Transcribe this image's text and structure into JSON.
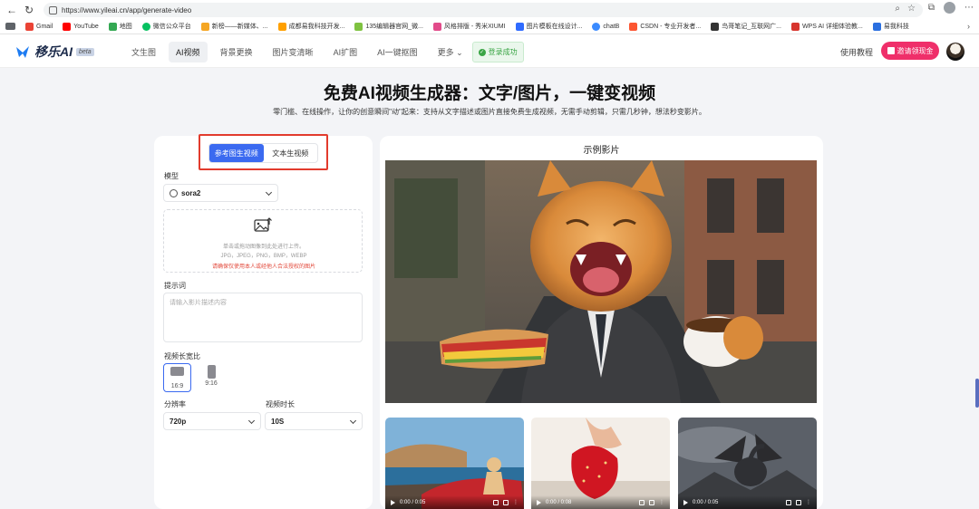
{
  "browser": {
    "url": "https://www.yileai.cn/app/generate-video",
    "bookmarks": [
      "Gmail",
      "YouTube",
      "地图",
      "微信公众平台",
      "新榜——新媒体、...",
      "成都易我科技开发...",
      "135编辑器官网_微...",
      "风格排版 - 秀米XIUMI",
      "图片模板在线设计...",
      "chatB",
      "CSDN - 专业开发者...",
      "鸟哥笔记_互联网广...",
      "WPS AI 详细体验教...",
      "易我科技"
    ]
  },
  "header": {
    "logo_text": "移乐AI",
    "beta": "beta",
    "nav": [
      "文生图",
      "AI视频",
      "背景更换",
      "图片变清晰",
      "AI扩图",
      "AI一键抠图",
      "更多"
    ],
    "active_nav": "AI视频",
    "login_status": "登录成功",
    "tutorial": "使用教程",
    "invite": "邀请领现金"
  },
  "hero": {
    "title": "免费AI视频生成器：文字/图片，一键变视频",
    "subtitle": "零门槛、在线操作，让你的创意瞬间\"动\"起来：支持从文字描述或图片直接免费生成视频，无需手动剪辑，只需几秒钟，想法秒变影片。"
  },
  "form": {
    "tabs": [
      "参考图生视频",
      "文本生视频"
    ],
    "model_label": "模型",
    "model_value": "sora2",
    "upload_hint": "单击或拖动图像到此处进行上传。",
    "upload_formats": "JPG，JPEG，PNG，BMP，WEBP",
    "upload_warning": "请确保仅使用本人或经他人合法授权的图片",
    "prompt_label": "提示词",
    "prompt_placeholder": "请输入影片描述内容",
    "ratio_label": "视频长宽比",
    "ratios": [
      "16:9",
      "9:16"
    ],
    "resolution_label": "分辨率",
    "resolution_value": "720p",
    "duration_label": "视频时长",
    "duration_value": "10S"
  },
  "examples": {
    "title": "示例影片",
    "videos": [
      {
        "time": "0:00 / 0:05"
      },
      {
        "time": "0:00 / 0:08"
      },
      {
        "time": "0:00 / 0:05"
      }
    ]
  },
  "colors": {
    "primary": "#3b6af0",
    "invite": "#ef2f6a",
    "highlight": "#e23b2d",
    "success": "#3aa545"
  }
}
